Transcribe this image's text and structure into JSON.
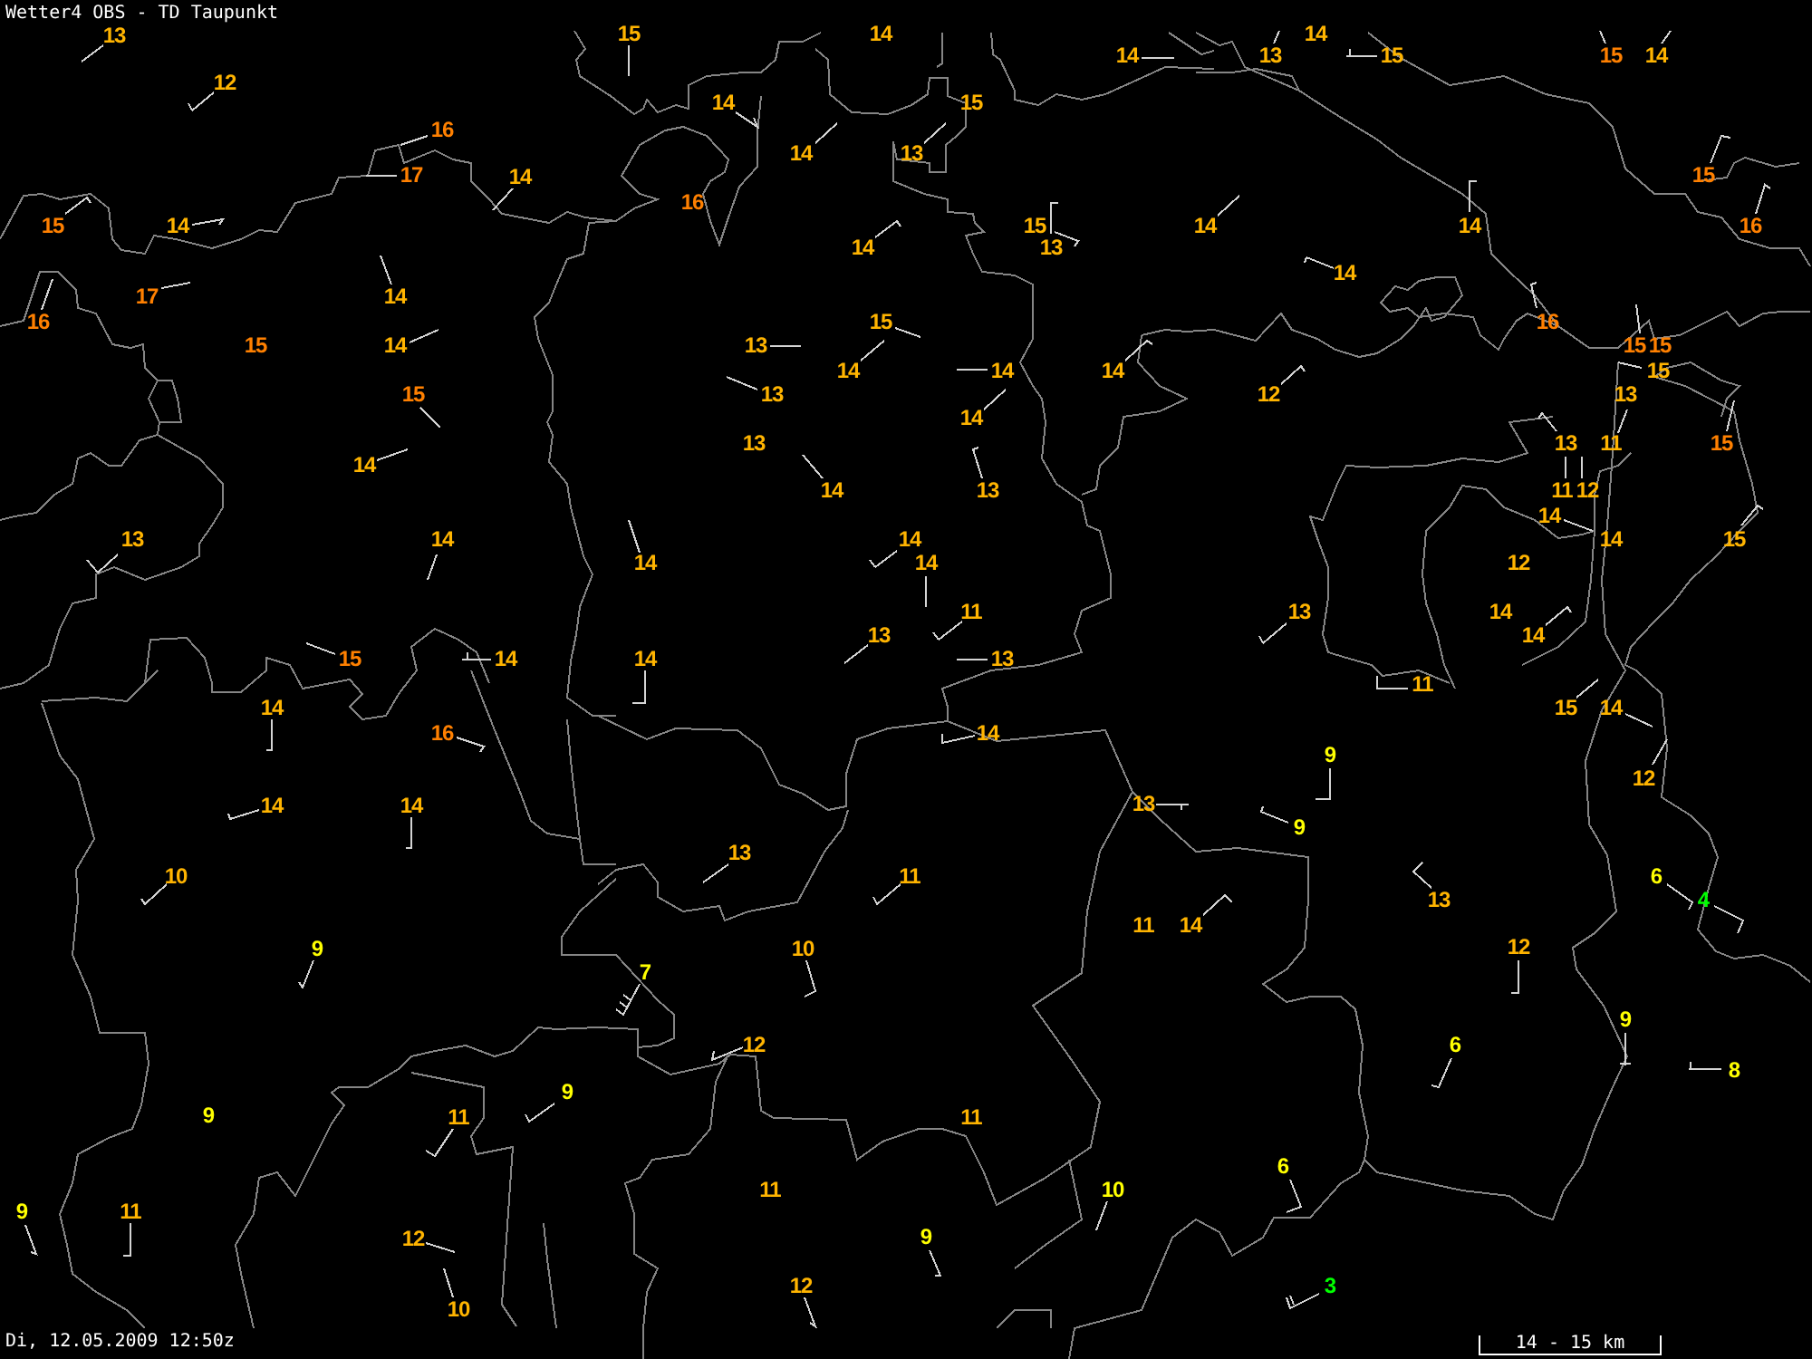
{
  "title": "Wetter4 OBS - TD Taupunkt",
  "stations": [
    {
      "value": "13",
      "color": "#ffb400"
    },
    {
      "value": "15",
      "color": "#ffb400"
    },
    {
      "value": "14",
      "color": "#ffb400"
    },
    {
      "value": "14",
      "color": "#ffb400"
    },
    {
      "value": "14",
      "color": "#ffb400"
    },
    {
      "value": "13",
      "color": "#ffb400"
    },
    {
      "value": "15",
      "color": "#ffb400"
    },
    {
      "value": "15",
      "color": "#ff8000"
    },
    {
      "value": "14",
      "color": "#ffb400"
    },
    {
      "value": "12",
      "color": "#ffb400"
    },
    {
      "value": "14",
      "color": "#ffb400"
    },
    {
      "value": "15",
      "color": "#ffb400"
    },
    {
      "value": "16",
      "color": "#ff8000"
    },
    {
      "value": "14",
      "color": "#ffb400"
    },
    {
      "value": "13",
      "color": "#ffb400"
    },
    {
      "value": "17",
      "color": "#ff8000"
    },
    {
      "value": "14",
      "color": "#ffb400"
    },
    {
      "value": "15",
      "color": "#ff8000"
    },
    {
      "value": "16",
      "color": "#ff8000"
    },
    {
      "value": "15",
      "color": "#ff8000"
    },
    {
      "value": "14",
      "color": "#ffb400"
    },
    {
      "value": "15",
      "color": "#ffb400"
    },
    {
      "value": "14",
      "color": "#ffb400"
    },
    {
      "value": "14",
      "color": "#ffb400"
    },
    {
      "value": "16",
      "color": "#ff8000"
    },
    {
      "value": "14",
      "color": "#ffb400"
    },
    {
      "value": "13",
      "color": "#ffb400"
    },
    {
      "value": "14",
      "color": "#ffb400"
    },
    {
      "value": "17",
      "color": "#ff8000"
    },
    {
      "value": "14",
      "color": "#ffb400"
    },
    {
      "value": "16",
      "color": "#ff8000"
    },
    {
      "value": "15",
      "color": "#ffb400"
    },
    {
      "value": "16",
      "color": "#ff8000"
    },
    {
      "value": "15",
      "color": "#ff8000"
    },
    {
      "value": "14",
      "color": "#ffb400"
    },
    {
      "value": "13",
      "color": "#ffb400"
    },
    {
      "value": "15",
      "color": "#ff8000"
    },
    {
      "value": "15",
      "color": "#ff8000"
    },
    {
      "value": "14",
      "color": "#ffb400"
    },
    {
      "value": "14",
      "color": "#ffb400"
    },
    {
      "value": "14",
      "color": "#ffb400"
    },
    {
      "value": "15",
      "color": "#ffb400"
    },
    {
      "value": "15",
      "color": "#ff8000"
    },
    {
      "value": "13",
      "color": "#ffb400"
    },
    {
      "value": "12",
      "color": "#ffb400"
    },
    {
      "value": "13",
      "color": "#ffb400"
    },
    {
      "value": "14",
      "color": "#ffb400"
    },
    {
      "value": "13",
      "color": "#ffb400"
    },
    {
      "value": "13",
      "color": "#ffb400"
    },
    {
      "value": "11",
      "color": "#ffb400"
    },
    {
      "value": "15",
      "color": "#ff8000"
    },
    {
      "value": "14",
      "color": "#ffb400"
    },
    {
      "value": "14",
      "color": "#ffb400"
    },
    {
      "value": "13",
      "color": "#ffb400"
    },
    {
      "value": "11",
      "color": "#ffb400"
    },
    {
      "value": "12",
      "color": "#ffb400"
    },
    {
      "value": "14",
      "color": "#ffb400"
    },
    {
      "value": "13",
      "color": "#ffb400"
    },
    {
      "value": "14",
      "color": "#ffb400"
    },
    {
      "value": "14",
      "color": "#ffb400"
    },
    {
      "value": "14",
      "color": "#ffb400"
    },
    {
      "value": "15",
      "color": "#ffb400"
    },
    {
      "value": "14",
      "color": "#ffb400"
    },
    {
      "value": "14",
      "color": "#ffb400"
    },
    {
      "value": "12",
      "color": "#ffb400"
    },
    {
      "value": "11",
      "color": "#ffb400"
    },
    {
      "value": "13",
      "color": "#ffb400"
    },
    {
      "value": "14",
      "color": "#ffb400"
    },
    {
      "value": "13",
      "color": "#ffb400"
    },
    {
      "value": "14",
      "color": "#ffb400"
    },
    {
      "value": "15",
      "color": "#ff8000"
    },
    {
      "value": "14",
      "color": "#ffb400"
    },
    {
      "value": "14",
      "color": "#ffb400"
    },
    {
      "value": "13",
      "color": "#ffb400"
    },
    {
      "value": "11",
      "color": "#ffb400"
    },
    {
      "value": "14",
      "color": "#ffb400"
    },
    {
      "value": "15",
      "color": "#ffb400"
    },
    {
      "value": "14",
      "color": "#ffb400"
    },
    {
      "value": "16",
      "color": "#ff8000"
    },
    {
      "value": "14",
      "color": "#ffb400"
    },
    {
      "value": "9",
      "color": "#ffff00"
    },
    {
      "value": "12",
      "color": "#ffb400"
    },
    {
      "value": "14",
      "color": "#ffb400"
    },
    {
      "value": "14",
      "color": "#ffb400"
    },
    {
      "value": "13",
      "color": "#ffb400"
    },
    {
      "value": "9",
      "color": "#ffff00"
    },
    {
      "value": "13",
      "color": "#ffb400"
    },
    {
      "value": "10",
      "color": "#ffb400"
    },
    {
      "value": "11",
      "color": "#ffb400"
    },
    {
      "value": "6",
      "color": "#ffff00"
    },
    {
      "value": "13",
      "color": "#ffb400"
    },
    {
      "value": "4",
      "color": "#00ff00"
    },
    {
      "value": "11",
      "color": "#ffb400"
    },
    {
      "value": "14",
      "color": "#ffb400"
    },
    {
      "value": "9",
      "color": "#ffff00"
    },
    {
      "value": "10",
      "color": "#ffb400"
    },
    {
      "value": "12",
      "color": "#ffb400"
    },
    {
      "value": "7",
      "color": "#ffff00"
    },
    {
      "value": "9",
      "color": "#ffff00"
    },
    {
      "value": "12",
      "color": "#ffb400"
    },
    {
      "value": "6",
      "color": "#ffff00"
    },
    {
      "value": "8",
      "color": "#ffff00"
    },
    {
      "value": "9",
      "color": "#ffff00"
    },
    {
      "value": "9",
      "color": "#ffff00"
    },
    {
      "value": "11",
      "color": "#ffb400"
    },
    {
      "value": "11",
      "color": "#ffb400"
    },
    {
      "value": "6",
      "color": "#ffff00"
    },
    {
      "value": "11",
      "color": "#ffb400"
    },
    {
      "value": "10",
      "color": "#ffff00"
    },
    {
      "value": "9",
      "color": "#ffff00"
    },
    {
      "value": "11",
      "color": "#ffb400"
    },
    {
      "value": "12",
      "color": "#ffb400"
    },
    {
      "value": "9",
      "color": "#ffff00"
    },
    {
      "value": "12",
      "color": "#ffb400"
    },
    {
      "value": "3",
      "color": "#00ff00"
    },
    {
      "value": "10",
      "color": "#ffb400"
    }
  ],
  "timestamp": "Di, 12.05.2009 12:50z",
  "scale_bar": {
    "label": "14 - 15 km"
  }
}
